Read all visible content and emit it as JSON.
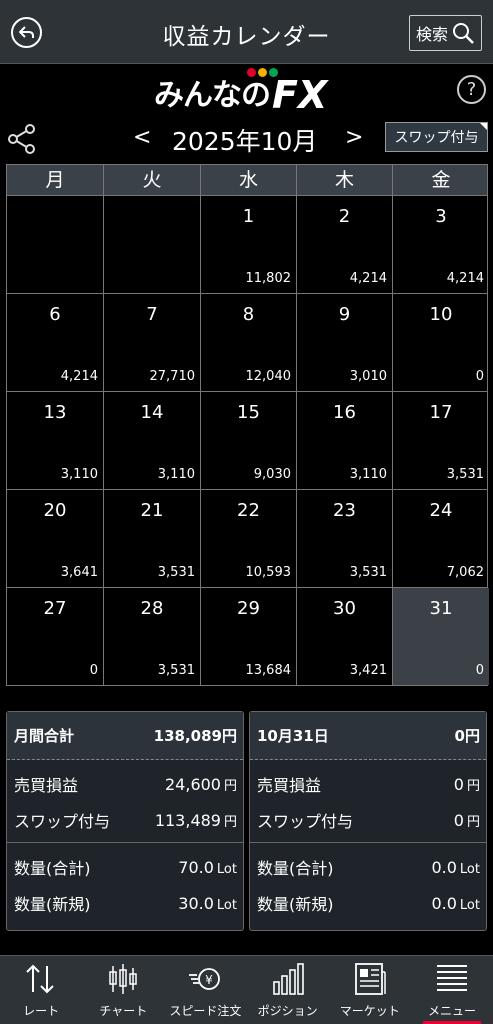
{
  "header": {
    "title": "収益カレンダー",
    "search_label": "検索"
  },
  "logo": {
    "text": "みんなの",
    "fx": "FX",
    "dot_colors": [
      "#e4002b",
      "#f2b200",
      "#00a650"
    ]
  },
  "help_label": "?",
  "month_nav": {
    "prev": "<",
    "label": "2025年10月",
    "next": ">"
  },
  "swap_toggle": "スワップ付与",
  "weekdays": [
    "月",
    "火",
    "水",
    "木",
    "金"
  ],
  "calendar": [
    [
      {
        "day": "",
        "value": ""
      },
      {
        "day": "",
        "value": ""
      },
      {
        "day": "1",
        "value": "11,802"
      },
      {
        "day": "2",
        "value": "4,214"
      },
      {
        "day": "3",
        "value": "4,214"
      }
    ],
    [
      {
        "day": "6",
        "value": "4,214"
      },
      {
        "day": "7",
        "value": "27,710"
      },
      {
        "day": "8",
        "value": "12,040"
      },
      {
        "day": "9",
        "value": "3,010"
      },
      {
        "day": "10",
        "value": "0"
      }
    ],
    [
      {
        "day": "13",
        "value": "3,110"
      },
      {
        "day": "14",
        "value": "3,110"
      },
      {
        "day": "15",
        "value": "9,030"
      },
      {
        "day": "16",
        "value": "3,110"
      },
      {
        "day": "17",
        "value": "3,531"
      }
    ],
    [
      {
        "day": "20",
        "value": "3,641"
      },
      {
        "day": "21",
        "value": "3,531"
      },
      {
        "day": "22",
        "value": "10,593"
      },
      {
        "day": "23",
        "value": "3,531"
      },
      {
        "day": "24",
        "value": "7,062"
      }
    ],
    [
      {
        "day": "27",
        "value": "0"
      },
      {
        "day": "28",
        "value": "3,531"
      },
      {
        "day": "29",
        "value": "13,684"
      },
      {
        "day": "30",
        "value": "3,421"
      },
      {
        "day": "31",
        "value": "0"
      }
    ]
  ],
  "summary_month": {
    "title": "月間合計",
    "total": "138,089",
    "total_unit": "円",
    "trade_label": "売買損益",
    "trade": "24,600",
    "trade_unit": "円",
    "swap_label": "スワップ付与",
    "swap": "113,489",
    "swap_unit": "円",
    "qty_total_label": "数量(合計)",
    "qty_total": "70.0",
    "qty_total_unit": "Lot",
    "qty_new_label": "数量(新規)",
    "qty_new": "30.0",
    "qty_new_unit": "Lot"
  },
  "summary_day": {
    "title": "10月31日",
    "total": "0",
    "total_unit": "円",
    "trade_label": "売買損益",
    "trade": "0",
    "trade_unit": "円",
    "swap_label": "スワップ付与",
    "swap": "0",
    "swap_unit": "円",
    "qty_total_label": "数量(合計)",
    "qty_total": "0.0",
    "qty_total_unit": "Lot",
    "qty_new_label": "数量(新規)",
    "qty_new": "0.0",
    "qty_new_unit": "Lot"
  },
  "bottom_nav": [
    {
      "label": "レート",
      "icon": "rate-arrows-icon"
    },
    {
      "label": "チャート",
      "icon": "candlestick-chart-icon"
    },
    {
      "label": "スピード注文",
      "icon": "speed-order-icon"
    },
    {
      "label": "ポジション",
      "icon": "bar-graph-icon"
    },
    {
      "label": "マーケット",
      "icon": "newspaper-icon"
    },
    {
      "label": "メニュー",
      "icon": "menu-lines-icon"
    }
  ],
  "active_nav": "メニュー"
}
